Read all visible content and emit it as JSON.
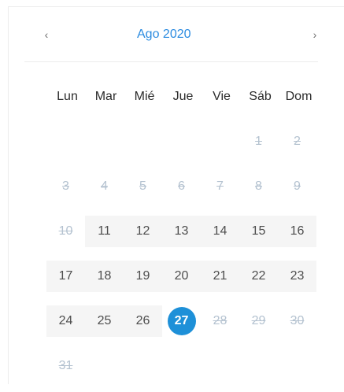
{
  "calendar": {
    "prev_label": "‹",
    "next_label": "›",
    "month_title": "Ago 2020",
    "weekdays": [
      "Lun",
      "Mar",
      "Mié",
      "Jue",
      "Vie",
      "Sáb",
      "Dom"
    ],
    "weeks": [
      [
        null,
        null,
        null,
        null,
        null,
        {
          "d": "1",
          "s": "disabled"
        },
        {
          "d": "2",
          "s": "disabled"
        }
      ],
      [
        {
          "d": "3",
          "s": "disabled"
        },
        {
          "d": "4",
          "s": "disabled"
        },
        {
          "d": "5",
          "s": "disabled"
        },
        {
          "d": "6",
          "s": "disabled"
        },
        {
          "d": "7",
          "s": "disabled"
        },
        {
          "d": "8",
          "s": "disabled"
        },
        {
          "d": "9",
          "s": "disabled"
        }
      ],
      [
        {
          "d": "10",
          "s": "disabled"
        },
        {
          "d": "11",
          "s": "range"
        },
        {
          "d": "12",
          "s": "range"
        },
        {
          "d": "13",
          "s": "range"
        },
        {
          "d": "14",
          "s": "range"
        },
        {
          "d": "15",
          "s": "range"
        },
        {
          "d": "16",
          "s": "range"
        }
      ],
      [
        {
          "d": "17",
          "s": "range"
        },
        {
          "d": "18",
          "s": "range"
        },
        {
          "d": "19",
          "s": "range"
        },
        {
          "d": "20",
          "s": "range"
        },
        {
          "d": "21",
          "s": "range"
        },
        {
          "d": "22",
          "s": "range"
        },
        {
          "d": "23",
          "s": "range"
        }
      ],
      [
        {
          "d": "24",
          "s": "range"
        },
        {
          "d": "25",
          "s": "range"
        },
        {
          "d": "26",
          "s": "range"
        },
        {
          "d": "27",
          "s": "selected"
        },
        {
          "d": "28",
          "s": "disabled"
        },
        {
          "d": "29",
          "s": "disabled"
        },
        {
          "d": "30",
          "s": "disabled"
        }
      ],
      [
        {
          "d": "31",
          "s": "disabled"
        },
        null,
        null,
        null,
        null,
        null,
        null
      ]
    ],
    "colors": {
      "accent": "#1e90d8",
      "title": "#2b8be0",
      "disabled": "#b4c2d0",
      "range_bg": "#f5f5f5"
    }
  }
}
